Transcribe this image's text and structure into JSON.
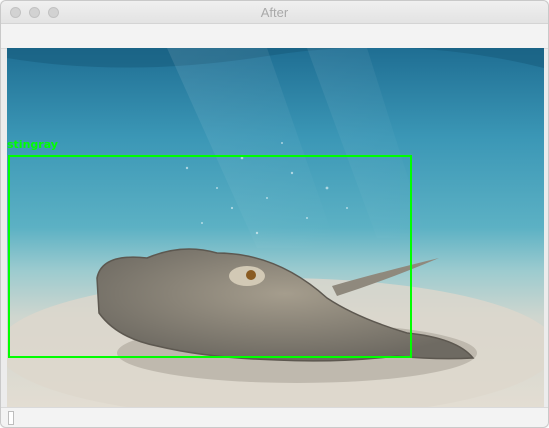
{
  "window": {
    "title": "After"
  },
  "detection": {
    "label": "stingray",
    "box_color": "#00ff00"
  },
  "colors": {
    "water_top": "#2f7fa3",
    "water_mid": "#3fa2bd",
    "sand": "#d9d6cd",
    "stingray": "#8a8478"
  }
}
